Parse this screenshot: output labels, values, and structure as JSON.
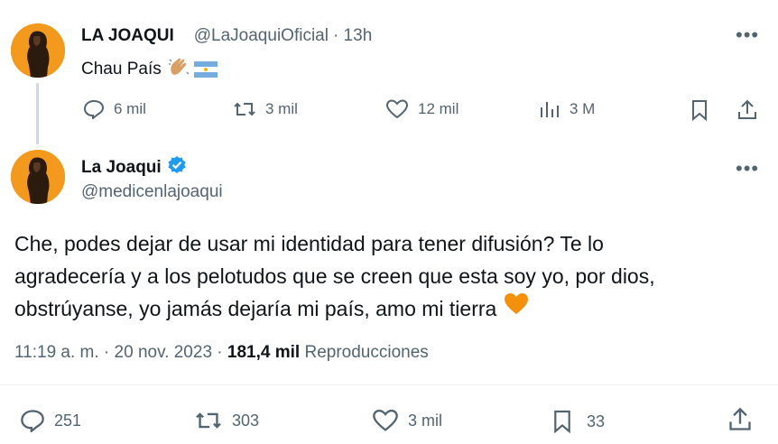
{
  "colors": {
    "accent": "#1d9bf0",
    "avatar": "#f39a1e",
    "heart": "#f4900c"
  },
  "reply_tweet": {
    "name": "LA JOAQUI",
    "handle": "@LaJoaquiOficial",
    "time": "· 13h",
    "text": "Chau País",
    "emojis": [
      "clapping-hands-icon",
      "argentina-flag-icon"
    ],
    "actions": {
      "replies": "6 mil",
      "retweets": "3 mil",
      "likes": "12 mil",
      "views": "3 M"
    }
  },
  "main_tweet": {
    "name": "La Joaqui",
    "handle": "@medicenlajoaqui",
    "verified": true,
    "text_lines": [
      "Che, podes dejar de usar mi identidad para tener difusión? Te lo",
      "agradecería y a los pelotudos que se creen que esta soy yo, por  dios,",
      "obstrúyanse, yo jamás dejaría mi país, amo mi tierra"
    ],
    "meta": {
      "time": "11:19 a. m.",
      "sep1": " · ",
      "date": "20 nov. 2023",
      "sep2": " · ",
      "views_count": "181,4 mil",
      "views_label": " Reproducciones"
    },
    "actions": {
      "replies": "251",
      "retweets": "303",
      "likes": "3 mil",
      "bookmarks": "33"
    }
  }
}
